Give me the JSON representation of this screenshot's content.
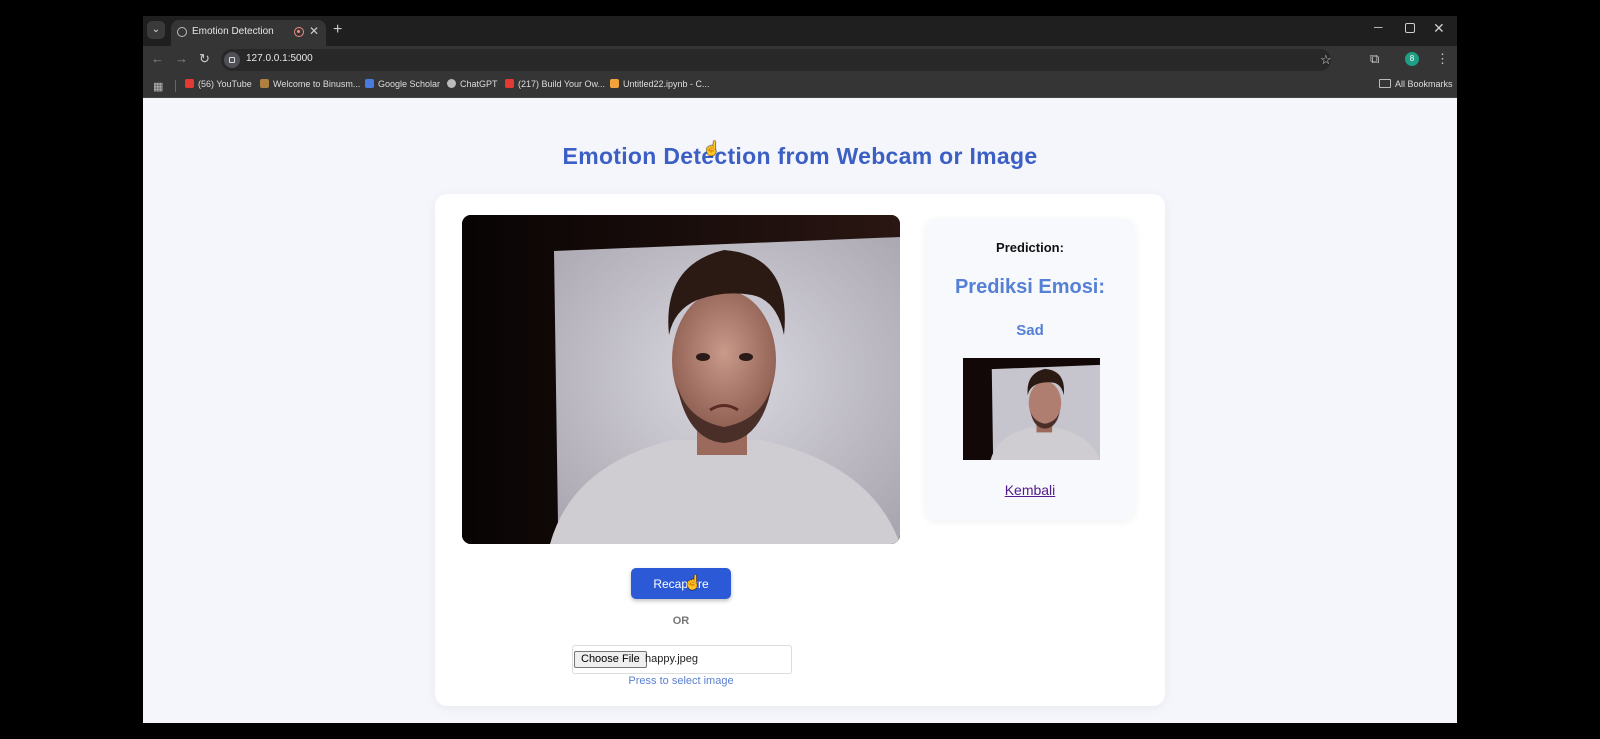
{
  "browser": {
    "tab_title": "Emotion Detection",
    "new_tab": "+",
    "url": "127.0.0.1:5000",
    "bookmarks": [
      {
        "label": "(56) YouTube",
        "color": "#e53935"
      },
      {
        "label": "Welcome to Binusm...",
        "color": "#b08040"
      },
      {
        "label": "Google Scholar",
        "color": "#4a7be0"
      },
      {
        "label": "ChatGPT",
        "color": "#bbbbbb"
      },
      {
        "label": "(217) Build Your Ow...",
        "color": "#e53935"
      },
      {
        "label": "Untitled22.ipynb - C...",
        "color": "#f2a33a"
      }
    ],
    "all_bookmarks": "All Bookmarks",
    "profile_initial": "8"
  },
  "page": {
    "title": "Emotion Detection from Webcam or Image",
    "capture_button": "Recapture",
    "or_label": "OR",
    "choose_file": "Choose File",
    "file_name": "happy.jpeg",
    "file_hint": "Press to select image"
  },
  "prediction": {
    "label": "Prediction:",
    "heading": "Prediksi Emosi:",
    "emotion": "Sad",
    "back_link": "Kembali"
  }
}
